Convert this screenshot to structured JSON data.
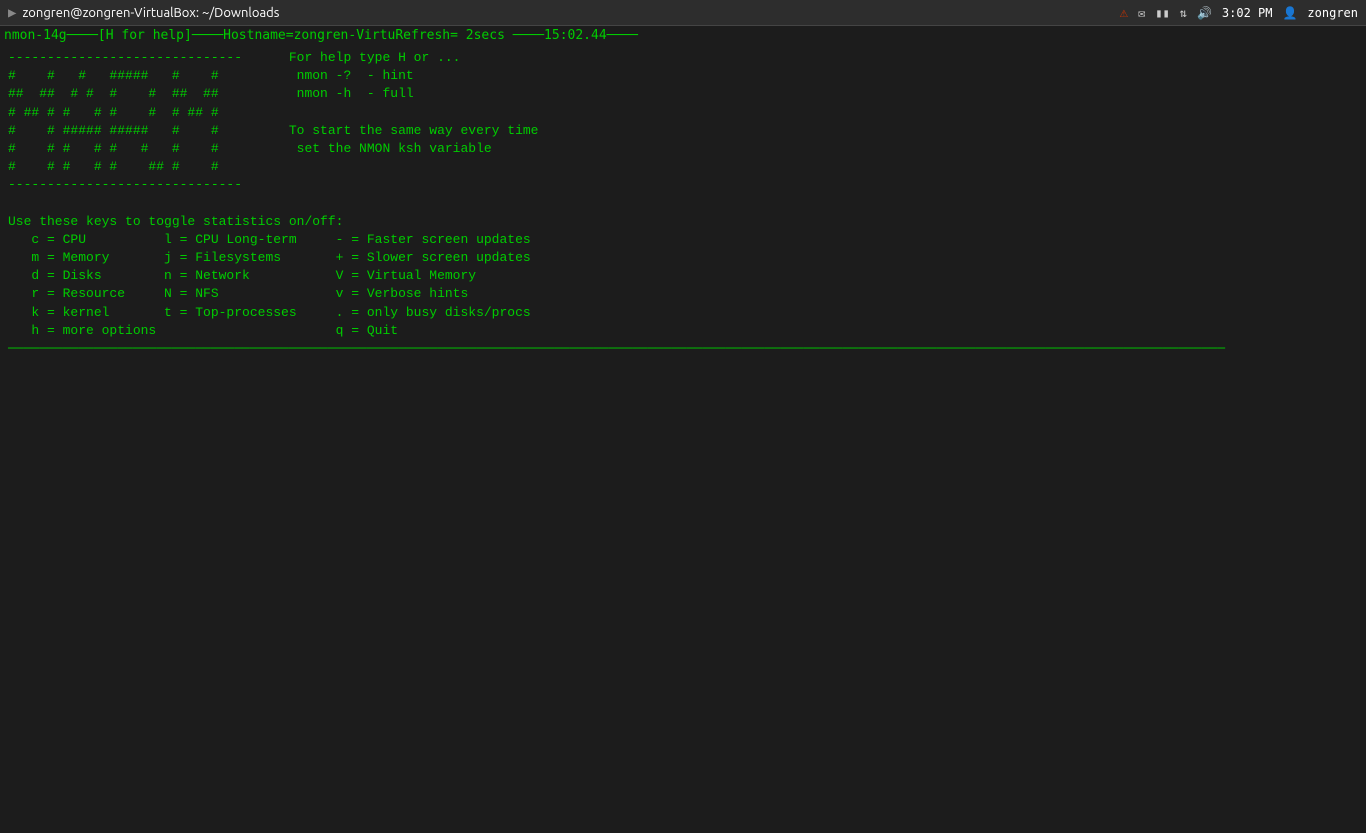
{
  "titlebar": {
    "title": "zongren@zongren-VirtualBox: ~/Downloads",
    "clock": "3:02 PM",
    "user": "zongren"
  },
  "terminal": {
    "status_bar": "nmon-14g────[H for help]────Hostname=zongren-VirtuRefresh= 2secs ────15:02.44────",
    "logo_lines": [
      "------------------------------",
      "#    #   #   #####   #    #",
      "##  ##  # #  #    #  ##  ##",
      "# ## # #   # #    #  # ## #",
      "#    # ##### #####   #    #",
      "#    # #   # #   #   #    #",
      "#    # #   # #    ## #    #",
      "------------------------------"
    ],
    "help_section": {
      "header": "For help type H or ...",
      "line1": " nmon -?  - hint",
      "line2": " nmon -h  - full",
      "blank": "",
      "line3": "To start the same way every time",
      "line4": " set the NMON ksh variable"
    },
    "toggle_header": "Use these keys to toggle statistics on/off:",
    "toggle_keys": [
      {
        "left_key": "c",
        "left_label": "CPU",
        "mid_key": "l",
        "mid_label": "CPU Long-term",
        "right_key": "-",
        "right_label": "Faster screen updates"
      },
      {
        "left_key": "m",
        "left_label": "Memory",
        "mid_key": "j",
        "mid_label": "Filesystems",
        "right_key": "+",
        "right_label": "Slower screen updates"
      },
      {
        "left_key": "d",
        "left_label": "Disks",
        "mid_key": "n",
        "mid_label": "Network",
        "right_key": "V",
        "right_label": "Virtual Memory"
      },
      {
        "left_key": "r",
        "left_label": "Resource",
        "mid_key": "N",
        "mid_label": "NFS",
        "right_key": "v",
        "right_label": "Verbose hints"
      },
      {
        "left_key": "k",
        "left_label": "kernel",
        "mid_key": "t",
        "mid_label": "Top-processes",
        "right_key": ".",
        "right_label": "only busy disks/procs"
      },
      {
        "left_key": "h",
        "left_label": "more options",
        "mid_key": "",
        "mid_label": "",
        "right_key": "q",
        "right_label": "Quit"
      }
    ],
    "divider_bottom": "────────────────────────────────────────────────────────────────────────────────────────────────────────────────────────────────────────────────────────────"
  }
}
